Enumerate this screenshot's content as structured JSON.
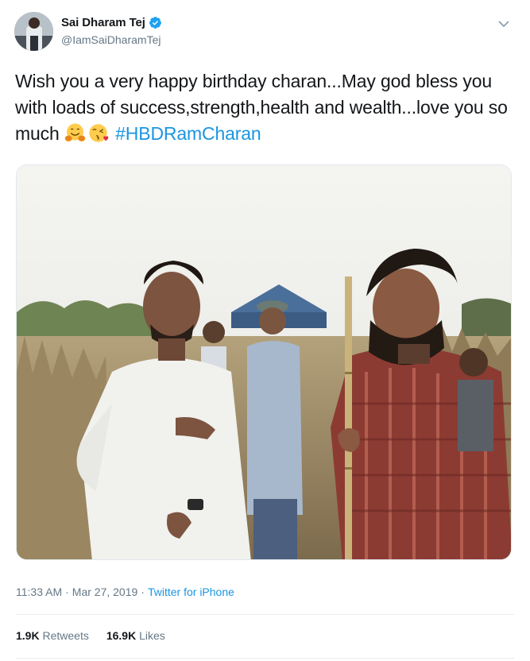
{
  "user": {
    "display_name": "Sai Dharam Tej",
    "handle": "@IamSaiDharamTej",
    "verified": true
  },
  "tweet": {
    "text": "Wish you a very happy birthday charan...May god bless you with loads of success,strength,health and wealth...love you so much",
    "emojis": [
      "hugging-face-emoji",
      "face-blowing-kiss-emoji"
    ],
    "hashtag": "#HBDRamCharan"
  },
  "meta": {
    "time": "11:33 AM",
    "sep1": "·",
    "date": "Mar 27, 2019",
    "sep2": "·",
    "source": "Twitter for iPhone"
  },
  "stats": {
    "retweets_count": "1.9K",
    "retweets_label": "Retweets",
    "likes_count": "16.9K",
    "likes_label": "Likes"
  },
  "colors": {
    "link": "#1b95e0",
    "text": "#14171a",
    "secondary": "#657786",
    "verified": "#1da1f2"
  }
}
